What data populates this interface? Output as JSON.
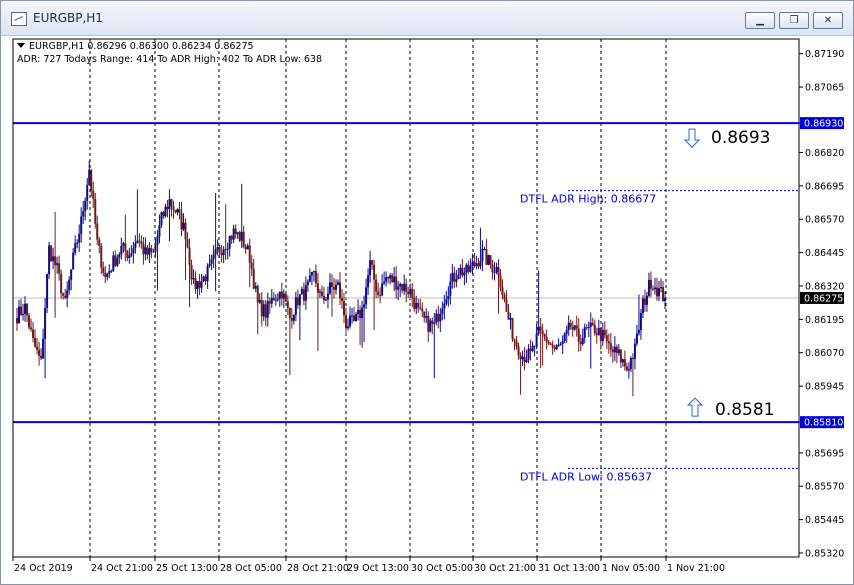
{
  "window": {
    "title": "EURGBP,H1",
    "minimize_icon": "minimize-icon",
    "restore_icon": "restore-icon",
    "close_icon": "close-icon"
  },
  "info": {
    "line1": "EURGBP,H1  0.86296 0.86300 0.86234 0.86275",
    "line2": "ADR: 727   Todays Range: 414   To ADR High: 402   To ADR Low: 638",
    "dropdown_icon": "triangle-down-icon"
  },
  "colors": {
    "bull": "#0a0a8c",
    "bear": "#6e1a1a",
    "level": "#0000dd",
    "annotation": "#0000cc",
    "current": "#000000"
  },
  "chart_data": {
    "type": "candlestick",
    "symbol": "EURGBP",
    "timeframe": "H1",
    "ohlc_header": {
      "open": 0.86296,
      "high": 0.863,
      "low": 0.86234,
      "close": 0.86275
    },
    "ylim": [
      0.85305,
      0.87245
    ],
    "y_ticks": [
      "0.87190",
      "0.87065",
      "0.86930",
      "0.86820",
      "0.86695",
      "0.86570",
      "0.86445",
      "0.86320",
      "0.86275",
      "0.86195",
      "0.86070",
      "0.85945",
      "0.85810",
      "0.85695",
      "0.85570",
      "0.85445",
      "0.85320"
    ],
    "x_ticks": [
      "24 Oct 2019",
      "24 Oct 21:00",
      "25 Oct 13:00",
      "28 Oct 05:00",
      "28 Oct 21:00",
      "29 Oct 13:00",
      "30 Oct 05:00",
      "30 Oct 21:00",
      "31 Oct 13:00",
      "1 Nov 05:00",
      "1 Nov 21:00"
    ],
    "levels": [
      {
        "name": "adr-high-level",
        "value": 0.8693,
        "label": "0.86930",
        "display": "0.8693",
        "arrow": "down-arrow-icon"
      },
      {
        "name": "adr-low-level",
        "value": 0.8581,
        "label": "0.85810",
        "display": "0.8581",
        "arrow": "up-arrow-icon"
      }
    ],
    "dtfl": [
      {
        "name": "dtfl-adr-high",
        "value": 0.86677,
        "text": "DTFL ADR High: 0.86677"
      },
      {
        "name": "dtfl-adr-low",
        "value": 0.85637,
        "text": "DTFL ADR Low: 0.85637"
      }
    ],
    "current_price": {
      "value": 0.86275,
      "label": "0.86275"
    },
    "anchors": [
      [
        0,
        0.8621
      ],
      [
        4,
        0.8624
      ],
      [
        8,
        0.8611
      ],
      [
        12,
        0.8603
      ],
      [
        16,
        0.8646
      ],
      [
        20,
        0.8638
      ],
      [
        24,
        0.8625
      ],
      [
        28,
        0.8642
      ],
      [
        32,
        0.8656
      ],
      [
        36,
        0.8676
      ],
      [
        40,
        0.8648
      ],
      [
        44,
        0.8635
      ],
      [
        48,
        0.8641
      ],
      [
        52,
        0.8646
      ],
      [
        56,
        0.8644
      ],
      [
        60,
        0.865
      ],
      [
        64,
        0.8644
      ],
      [
        68,
        0.8644
      ],
      [
        72,
        0.8657
      ],
      [
        76,
        0.8664
      ],
      [
        80,
        0.8659
      ],
      [
        84,
        0.8652
      ],
      [
        88,
        0.8632
      ],
      [
        92,
        0.8634
      ],
      [
        96,
        0.8638
      ],
      [
        100,
        0.8645
      ],
      [
        104,
        0.8648
      ],
      [
        108,
        0.8652
      ],
      [
        112,
        0.865
      ],
      [
        116,
        0.8643
      ],
      [
        120,
        0.8625
      ],
      [
        124,
        0.8622
      ],
      [
        128,
        0.8628
      ],
      [
        132,
        0.863
      ],
      [
        136,
        0.862
      ],
      [
        140,
        0.8627
      ],
      [
        144,
        0.863
      ],
      [
        148,
        0.8636
      ],
      [
        152,
        0.8626
      ],
      [
        156,
        0.8631
      ],
      [
        160,
        0.8632
      ],
      [
        164,
        0.8618
      ],
      [
        168,
        0.8618
      ],
      [
        172,
        0.8623
      ],
      [
        176,
        0.864
      ],
      [
        180,
        0.8629
      ],
      [
        184,
        0.8635
      ],
      [
        188,
        0.8634
      ],
      [
        192,
        0.8632
      ],
      [
        196,
        0.863
      ],
      [
        200,
        0.8622
      ],
      [
        204,
        0.8618
      ],
      [
        208,
        0.8617
      ],
      [
        212,
        0.8626
      ],
      [
        216,
        0.8633
      ],
      [
        220,
        0.8638
      ],
      [
        224,
        0.8637
      ],
      [
        228,
        0.864
      ],
      [
        232,
        0.8644
      ],
      [
        236,
        0.864
      ],
      [
        240,
        0.8638
      ],
      [
        244,
        0.8622
      ],
      [
        248,
        0.8612
      ],
      [
        252,
        0.8606
      ],
      [
        256,
        0.8606
      ],
      [
        260,
        0.8614
      ],
      [
        264,
        0.8612
      ],
      [
        268,
        0.8608
      ],
      [
        272,
        0.861
      ],
      [
        276,
        0.8617
      ],
      [
        280,
        0.8612
      ],
      [
        284,
        0.8615
      ],
      [
        288,
        0.8616
      ],
      [
        292,
        0.8613
      ],
      [
        296,
        0.8608
      ],
      [
        300,
        0.8606
      ],
      [
        304,
        0.8601
      ],
      [
        308,
        0.8608
      ],
      [
        312,
        0.8625
      ],
      [
        316,
        0.8634
      ],
      [
        320,
        0.863
      ],
      [
        323,
        0.86275
      ]
    ]
  }
}
